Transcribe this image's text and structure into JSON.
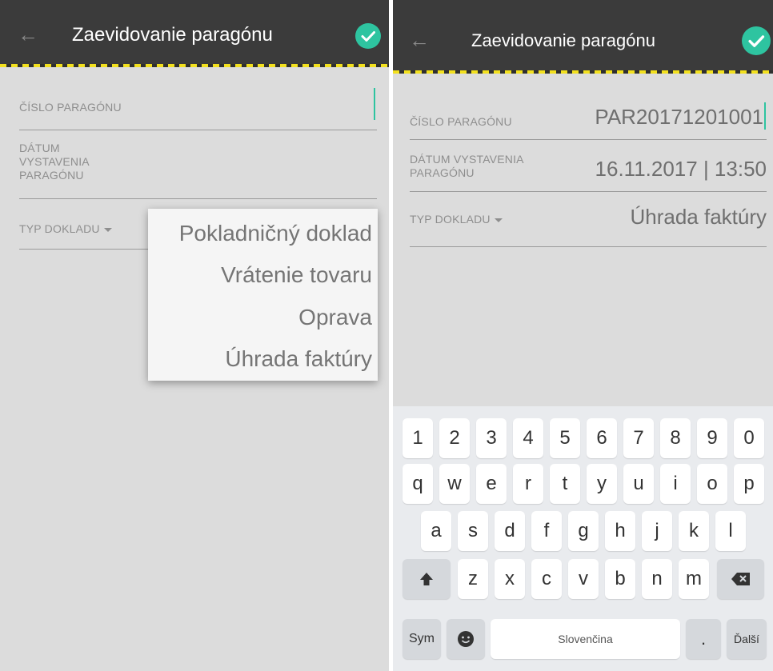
{
  "left_screen": {
    "toolbar": {
      "back_icon": "arrow-left-icon",
      "title": "Zaevidovanie paragónu",
      "confirm_icon": "check-icon",
      "accent_color": "#2ec4a0",
      "stripe_color": "#f2e01e"
    },
    "fields": {
      "receipt_number_label": "ČÍSLO PARAGÓNU",
      "issue_date_label_line1": "DÁTUM",
      "issue_date_label_line2": "VYSTAVENIA",
      "issue_date_label_line3": "PARAGÓNU",
      "doc_type_label": "TYP DOKLADU"
    },
    "dropdown_menu": {
      "items": [
        "Pokladničný doklad",
        "Vrátenie tovaru",
        "Oprava",
        "Úhrada faktúry"
      ]
    }
  },
  "right_screen": {
    "toolbar": {
      "back_icon": "arrow-left-icon",
      "title": "Zaevidovanie paragónu",
      "confirm_icon": "check-icon"
    },
    "fields": {
      "receipt_number_label": "ČÍSLO PARAGÓNU",
      "receipt_number_value": "PAR20171201001",
      "issue_date_label_line1": "DÁTUM VYSTAVENIA",
      "issue_date_label_line2": "PARAGÓNU",
      "issue_date_value": "16.11.2017 | 13:50",
      "doc_type_label": "TYP DOKLADU",
      "doc_type_value": "Úhrada faktúry"
    },
    "keyboard": {
      "row_numbers": [
        "1",
        "2",
        "3",
        "4",
        "5",
        "6",
        "7",
        "8",
        "9",
        "0"
      ],
      "row_1": [
        "q",
        "w",
        "e",
        "r",
        "t",
        "y",
        "u",
        "i",
        "o",
        "p"
      ],
      "row_2": [
        "a",
        "s",
        "d",
        "f",
        "g",
        "h",
        "j",
        "k",
        "l"
      ],
      "row_3": [
        "z",
        "x",
        "c",
        "v",
        "b",
        "n",
        "m"
      ],
      "shift_icon": "shift-arrow-icon",
      "backspace_icon": "backspace-icon",
      "sym_label": "Sym",
      "emoji_icon": "emoji-smile-icon",
      "space_label": "Slovenčina",
      "period_label": ".",
      "next_label": "Ďalší"
    }
  }
}
